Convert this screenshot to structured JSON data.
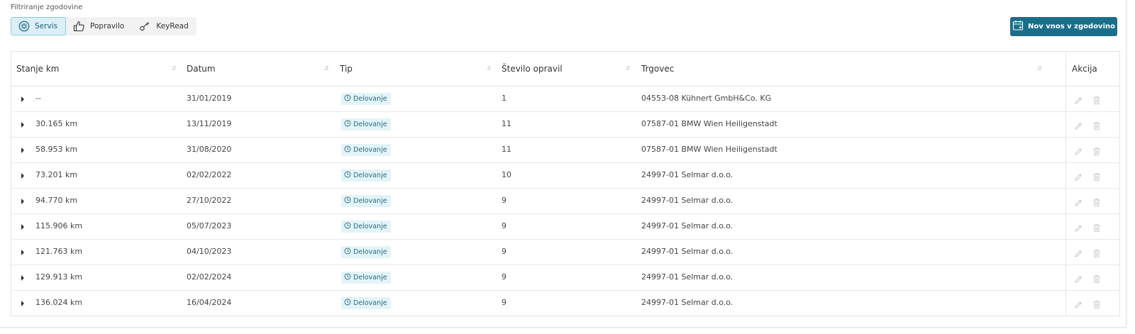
{
  "filter": {
    "label": "Filtriranje zgodovine",
    "buttons": [
      {
        "label": "Servis",
        "icon": "gear-circle-icon",
        "active": true
      },
      {
        "label": "Popravilo",
        "icon": "thumbs-up-icon",
        "active": false
      },
      {
        "label": "KeyRead",
        "icon": "key-icon",
        "active": false
      }
    ]
  },
  "new_entry_button": {
    "label": "Nov vnos v zgodovino",
    "icon": "calendar-add-icon"
  },
  "colors": {
    "accent": "#1b6e8a",
    "active_filter_bg": "#dbeff7",
    "tag_bg": "#e3f4f8"
  },
  "table": {
    "columns": [
      "Stanje km",
      "Datum",
      "Tip",
      "Število opravil",
      "Trgovec",
      "Akcija"
    ],
    "rows": [
      {
        "km": "--",
        "datum": "31/01/2019",
        "tip": "Delovanje",
        "opravila": "1",
        "trgovec": "04553-08 Kühnert GmbH&Co. KG"
      },
      {
        "km": "30.165 km",
        "datum": "13/11/2019",
        "tip": "Delovanje",
        "opravila": "11",
        "trgovec": "07587-01 BMW Wien Heiligenstadt"
      },
      {
        "km": "58.953 km",
        "datum": "31/08/2020",
        "tip": "Delovanje",
        "opravila": "11",
        "trgovec": "07587-01 BMW Wien Heiligenstadt"
      },
      {
        "km": "73.201 km",
        "datum": "02/02/2022",
        "tip": "Delovanje",
        "opravila": "10",
        "trgovec": "24997-01 Selmar d.o.o."
      },
      {
        "km": "94.770 km",
        "datum": "27/10/2022",
        "tip": "Delovanje",
        "opravila": "9",
        "trgovec": "24997-01 Selmar d.o.o."
      },
      {
        "km": "115.906 km",
        "datum": "05/07/2023",
        "tip": "Delovanje",
        "opravila": "9",
        "trgovec": "24997-01 Selmar d.o.o."
      },
      {
        "km": "121.763 km",
        "datum": "04/10/2023",
        "tip": "Delovanje",
        "opravila": "9",
        "trgovec": "24997-01 Selmar d.o.o."
      },
      {
        "km": "129.913 km",
        "datum": "02/02/2024",
        "tip": "Delovanje",
        "opravila": "9",
        "trgovec": "24997-01 Selmar d.o.o."
      },
      {
        "km": "136.024 km",
        "datum": "16/04/2024",
        "tip": "Delovanje",
        "opravila": "9",
        "trgovec": "24997-01 Selmar d.o.o."
      }
    ]
  }
}
